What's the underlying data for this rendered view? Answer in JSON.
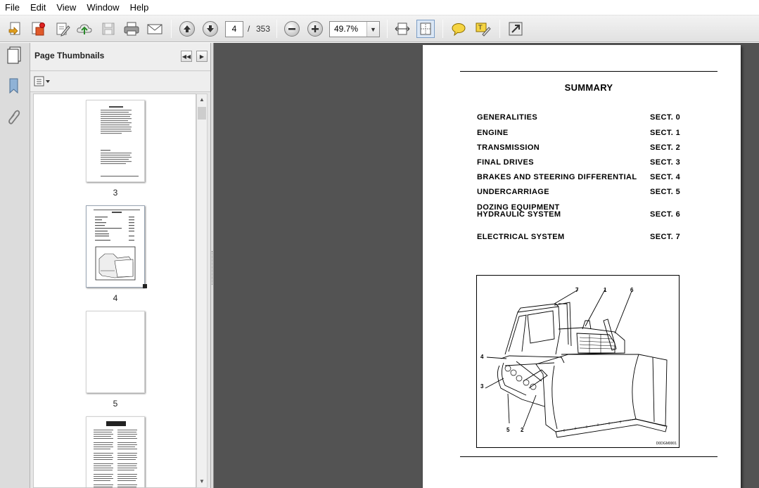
{
  "menu": [
    "File",
    "Edit",
    "View",
    "Window",
    "Help"
  ],
  "toolbar": {
    "current_page": "4",
    "page_separator": "/",
    "total_pages": "353",
    "zoom": "49.7%"
  },
  "sidebar": {
    "title": "Page Thumbnails",
    "thumbnails": [
      {
        "label": "3"
      },
      {
        "label": "4"
      },
      {
        "label": "5"
      },
      {
        "label": ""
      }
    ]
  },
  "document": {
    "title": "SUMMARY",
    "toc": [
      {
        "name": "GENERALITIES",
        "section": "SECT. 0"
      },
      {
        "name": "ENGINE",
        "section": "SECT. 1"
      },
      {
        "name": "TRANSMISSION",
        "section": "SECT. 2"
      },
      {
        "name": "FINAL DRIVES",
        "section": "SECT. 3"
      },
      {
        "name": "BRAKES AND STEERING DIFFERENTIAL",
        "section": "SECT. 4"
      },
      {
        "name": "UNDERCARRIAGE",
        "section": "SECT. 5"
      },
      {
        "name_line1": "DOZING EQUIPMENT",
        "name_line2": "HYDRAULIC SYSTEM",
        "section": "SECT. 6"
      },
      {
        "name": "ELECTRICAL SYSTEM",
        "section": "SECT. 7"
      }
    ],
    "figure": {
      "callouts": [
        "7",
        "1",
        "6",
        "4",
        "3",
        "5",
        "2"
      ],
      "code": "D0DGM0001"
    }
  }
}
